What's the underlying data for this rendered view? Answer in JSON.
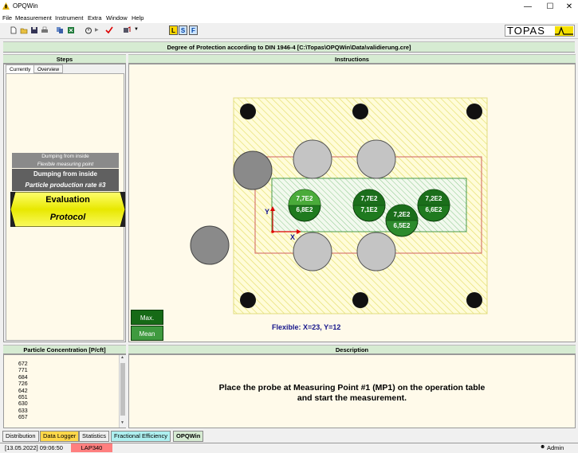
{
  "window": {
    "title": "OPQWin"
  },
  "menu": [
    "File",
    "Measurement",
    "Instrument",
    "Extra",
    "Window",
    "Help"
  ],
  "toolbar": {
    "lsf": [
      "L",
      "S",
      "F"
    ]
  },
  "logo": "TOPAS",
  "header": {
    "title": "Degree of Protection according to DIN 1946-4 [C:\\Topas\\OPQWin\\Data\\validierung.cre]"
  },
  "steps": {
    "title": "Steps",
    "tabs": [
      "Currently",
      "Overview"
    ],
    "items": [
      "Dumping from inside",
      "Flexible measuring point",
      "Dumping from inside",
      "Particle production rate #3",
      "Evaluation",
      "Protocol"
    ]
  },
  "instructions": {
    "title": "Instructions",
    "axis_y": "Y",
    "axis_x": "X",
    "points": [
      {
        "top": "7,7E2",
        "bottom": "6,8E2"
      },
      {
        "top": "7,7E2",
        "bottom": "7,1E2"
      },
      {
        "top": "7,2E2",
        "bottom": "6,6E2"
      },
      {
        "top": "7,2E2",
        "bottom": "6,5E2"
      }
    ],
    "flexible": "Flexible: X=23, Y=12",
    "max_label": "Max.",
    "mean_label": "Mean"
  },
  "concentration": {
    "title": "Particle Concentration [P/cft]",
    "values": [
      "672",
      "771",
      "684",
      "726",
      "642",
      "651",
      "630",
      "633",
      "657"
    ]
  },
  "description": {
    "title": "Description",
    "text_line1": "Place the probe at Measuring Point #1 (MP1) on the operation table",
    "text_line2": "and start the measurement."
  },
  "bottom_tabs": [
    "Distribution",
    "Data Logger",
    "Statistics",
    "Fractional Efficiency",
    "OPQWin"
  ],
  "status": {
    "datetime": "[13.05.2022]   09:06:50",
    "device": "LAP340",
    "user": "Admin"
  },
  "colors": {
    "header_green": "#d6ebd2",
    "panel_bg": "#fffaea",
    "dark_green": "#1e7a1e",
    "evaluation_yellow": "#ffff00",
    "device_red": "#ff7f7f"
  }
}
